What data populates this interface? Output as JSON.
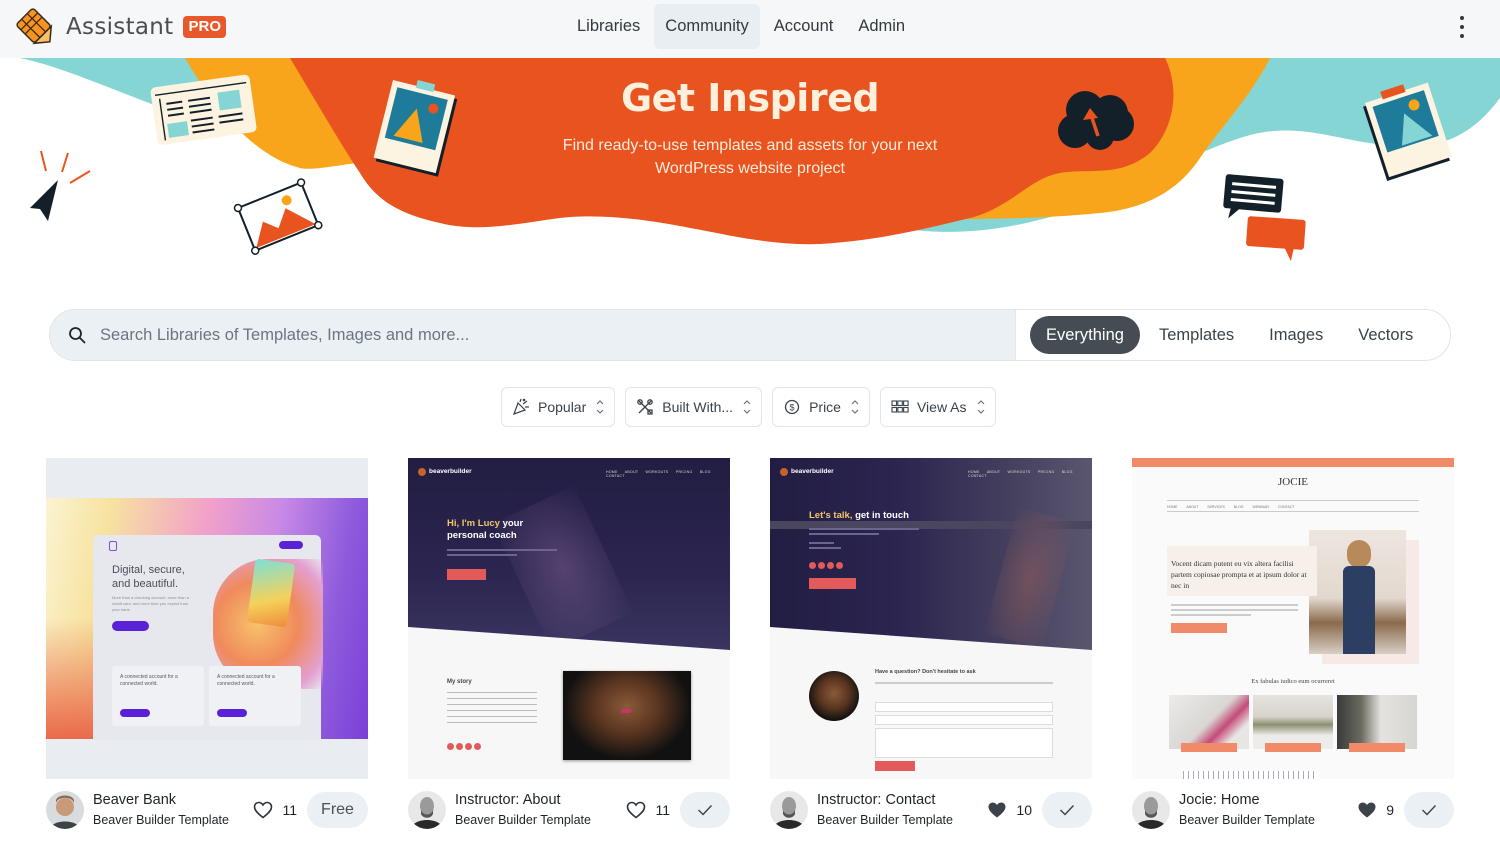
{
  "app": {
    "name": "Assistant",
    "badge": "PRO",
    "logo_icon": "pencil-grid-logo-icon"
  },
  "nav": {
    "items": [
      {
        "label": "Libraries",
        "active": false
      },
      {
        "label": "Community",
        "active": true
      },
      {
        "label": "Account",
        "active": false
      },
      {
        "label": "Admin",
        "active": false
      }
    ],
    "menu_icon": "kebab-menu-icon"
  },
  "banner": {
    "title": "Get Inspired",
    "subtitle": "Find ready-to-use templates and assets for your next WordPress website project",
    "colors": {
      "orange": "#e9531f",
      "yellow": "#f8a51b",
      "teal": "#86d5d5",
      "navy": "#13202a",
      "cream": "#fdf3e1",
      "blue": "#1e7b9a"
    }
  },
  "search": {
    "placeholder": "Search Libraries of Templates, Images and more...",
    "value": "",
    "icon": "search-icon",
    "tabs": [
      {
        "label": "Everything",
        "active": true
      },
      {
        "label": "Templates",
        "active": false
      },
      {
        "label": "Images",
        "active": false
      },
      {
        "label": "Vectors",
        "active": false
      }
    ]
  },
  "filters": [
    {
      "label": "Popular",
      "icon": "party-popper-icon"
    },
    {
      "label": "Built With...",
      "icon": "tools-icon"
    },
    {
      "label": "Price",
      "icon": "dollar-coin-icon"
    },
    {
      "label": "View As",
      "icon": "grid-view-icon"
    }
  ],
  "cards": [
    {
      "title": "Beaver Bank",
      "subtitle": "Beaver Builder Template",
      "likes": "11",
      "liked": false,
      "action": "Free",
      "thumb": {
        "headline": "Digital, secure, and beautiful.",
        "body": "More than a checking account, more than a credit card, and more than you expect from your bank.",
        "box1": "A connected account for a connected world.",
        "box2": "A connected account for a connected world."
      }
    },
    {
      "title": "Instructor: About",
      "subtitle": "Beaver Builder Template",
      "likes": "11",
      "liked": false,
      "action": "check",
      "thumb": {
        "brand": "beaverbuilder",
        "nav": [
          "HOME",
          "ABOUT",
          "WORKOUTS",
          "PRICING",
          "BLOG",
          "CONTACT"
        ],
        "headline_accent": "Hi, I'm Lucy",
        "headline_rest": " your personal coach",
        "section": "My story"
      }
    },
    {
      "title": "Instructor: Contact",
      "subtitle": "Beaver Builder Template",
      "likes": "10",
      "liked": true,
      "action": "check",
      "thumb": {
        "brand": "beaverbuilder",
        "nav": [
          "HOME",
          "ABOUT",
          "WORKOUTS",
          "PRICING",
          "BLOG",
          "CONTACT"
        ],
        "headline_accent": "Let's talk,",
        "headline_rest": " get in touch",
        "question": "Have a question? Don't hesitate to ask"
      }
    },
    {
      "title": "Jocie: Home",
      "subtitle": "Beaver Builder Template",
      "likes": "9",
      "liked": true,
      "action": "check",
      "thumb": {
        "brand": "JOCIE",
        "hero_text": "Vocent dicam putent eu vix altera facilisi partem copiosae prompta et at ipsum dolor at nec in",
        "section": "Ex fabulas iudico eum ocurreret"
      }
    }
  ]
}
